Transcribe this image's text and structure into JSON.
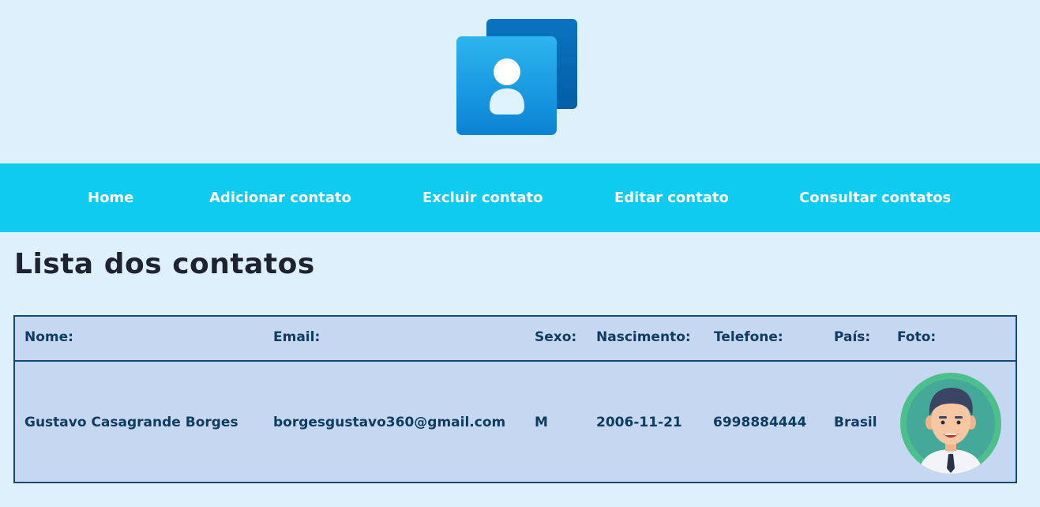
{
  "nav": {
    "items": [
      "Home",
      "Adicionar contato",
      "Excluir contato",
      "Editar contato",
      "Consultar contatos"
    ]
  },
  "page": {
    "title": "Lista dos contatos"
  },
  "table": {
    "headers": [
      "Nome:",
      "Email:",
      "Sexo:",
      "Nascimento:",
      "Telefone:",
      "País:",
      "Foto:"
    ],
    "rows": [
      [
        "Gustavo Casagrande Borges",
        "borgesgustavo360@gmail.com",
        "M",
        "2006-11-21",
        "6998884444",
        "Brasil",
        ""
      ]
    ]
  },
  "colors": {
    "background": "#dff0fd",
    "nav": "#0ecbef",
    "table_bg": "#c6d7f1",
    "table_border": "#0f4a78",
    "table_text": "#0f3c61"
  },
  "icons": {
    "logo": "contacts-logo-icon",
    "photo": "user-avatar-icon"
  }
}
